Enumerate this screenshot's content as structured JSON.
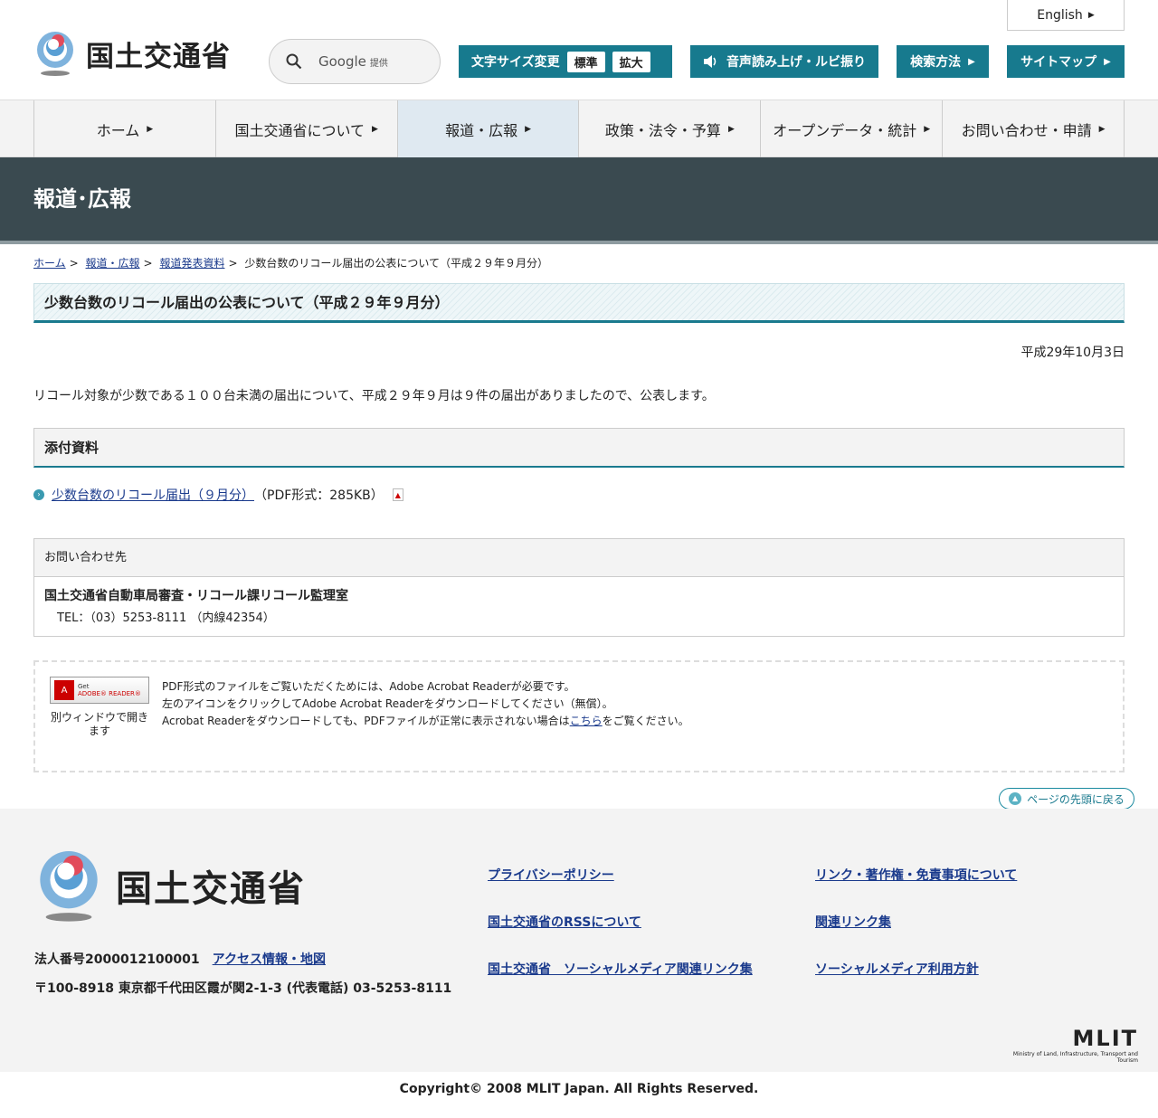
{
  "header": {
    "ministry_name": "国土交通省",
    "english_label": "English",
    "search_engine": "Google",
    "search_provided": "提供",
    "fontsize_label": "文字サイズ変更",
    "fontsize_standard": "標準",
    "fontsize_large": "拡大",
    "voice_label": "音声読み上げ・ルビ振り",
    "howto_label": "検索方法",
    "sitemap_label": "サイトマップ"
  },
  "nav": {
    "items": [
      {
        "label": "ホーム"
      },
      {
        "label": "国土交通省について"
      },
      {
        "label": "報道・広報"
      },
      {
        "label": "政策・法令・予算"
      },
      {
        "label": "オープンデータ・統計"
      },
      {
        "label": "お問い合わせ・申請"
      }
    ]
  },
  "band_title": "報道･広報",
  "breadcrumb": {
    "home": "ホーム",
    "press": "報道・広報",
    "release": "報道発表資料",
    "current": "少数台数のリコール届出の公表について（平成２９年９月分）",
    "sep": ">"
  },
  "main": {
    "title": "少数台数のリコール届出の公表について（平成２９年９月分）",
    "date": "平成29年10月3日",
    "lead": "リコール対象が少数である１００台未満の届出について、平成２９年９月は９件の届出がありましたので、公表します。",
    "attachments_heading": "添付資料",
    "attachment_link": "少数台数のリコール届出（９月分）",
    "attachment_meta": "（PDF形式：285KB）"
  },
  "contact": {
    "heading": "お問い合わせ先",
    "dept": "国土交通省自動車局審査・リコール課リコール監理室",
    "tel": "TEL：（03）5253-8111 （内線42354）"
  },
  "pdfnote": {
    "badge_get": "Get",
    "badge_reader": "ADOBE® READER®",
    "caption": "別ウィンドウで開きます",
    "line1": "PDF形式のファイルをご覧いただくためには、Adobe Acrobat Readerが必要です。",
    "line2": "左のアイコンをクリックしてAdobe Acrobat Readerをダウンロードしてください（無償）。",
    "line3_pre": "Acrobat Readerをダウンロードしても、PDFファイルが正常に表示されない場合は",
    "line3_link": "こちら",
    "line3_post": "をご覧ください。"
  },
  "pagetop_label": "ページの先頭に戻る",
  "footer": {
    "ministry_name": "国土交通省",
    "corp_number": "法人番号2000012100001",
    "access": "アクセス情報・地図",
    "address": "〒100-8918 東京都千代田区霞が関2-1-3 (代表電話) 03-5253-8111",
    "links_col1": [
      "プライバシーポリシー",
      "国土交通省のRSSについて",
      "国土交通省　ソーシャルメディア関連リンク集"
    ],
    "links_col2": [
      "リンク・著作権・免責事項について",
      "関連リンク集",
      "ソーシャルメディア利用方針"
    ],
    "mlit_big": "MLIT",
    "mlit_small": "Ministry of Land, Infrastructure, Transport and Tourism",
    "copyright": "Copyright© 2008 MLIT Japan. All Rights Reserved."
  }
}
